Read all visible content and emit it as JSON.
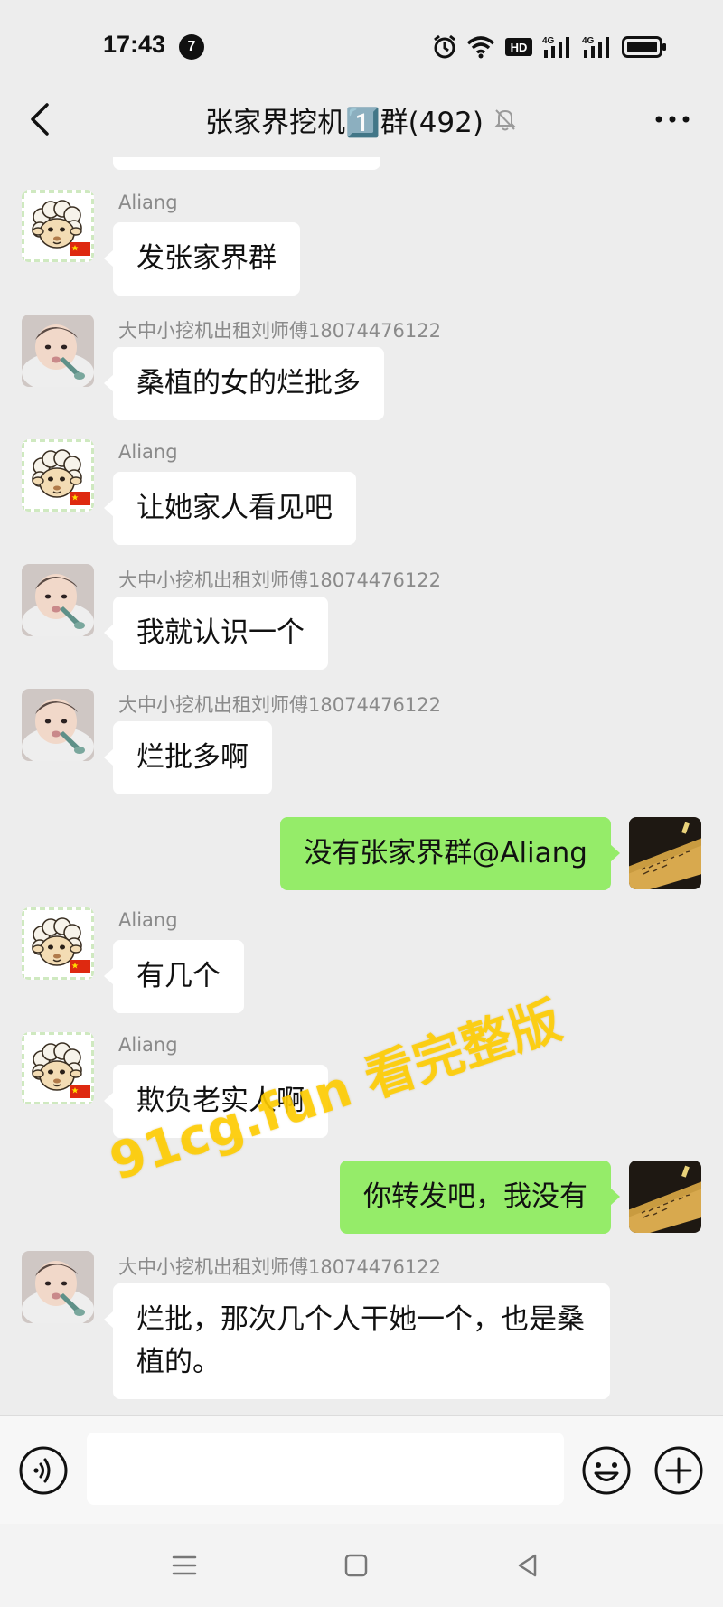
{
  "status_bar": {
    "time": "17:43",
    "notification_count": "7",
    "hd_badge": "HD",
    "signal_1_label": "4G",
    "signal_2_label": "4G"
  },
  "header": {
    "title": "张家界挖机1️⃣群(492)",
    "mute_icon": "bell-off-icon",
    "more_icon": "more-dots-icon"
  },
  "messages": [
    {
      "side": "left",
      "sender": "Aliang",
      "avatar": "lamb-avatar",
      "text": "发张家界群"
    },
    {
      "side": "left",
      "sender": "大中小挖机出租刘师傅18074476122",
      "avatar": "baby-avatar",
      "text": "桑植的女的烂批多"
    },
    {
      "side": "left",
      "sender": "Aliang",
      "avatar": "lamb-avatar",
      "text": "让她家人看见吧"
    },
    {
      "side": "left",
      "sender": "大中小挖机出租刘师傅18074476122",
      "avatar": "baby-avatar",
      "text": "我就认识一个"
    },
    {
      "side": "left",
      "sender": "大中小挖机出租刘师傅18074476122",
      "avatar": "baby-avatar",
      "text": "烂批多啊"
    },
    {
      "side": "right",
      "sender": "",
      "avatar": "self-avatar",
      "text": "没有张家界群@Aliang"
    },
    {
      "side": "left",
      "sender": "Aliang",
      "avatar": "lamb-avatar",
      "text": "有几个"
    },
    {
      "side": "left",
      "sender": "Aliang",
      "avatar": "lamb-avatar",
      "text": "欺负老实人啊"
    },
    {
      "side": "right",
      "sender": "",
      "avatar": "self-avatar",
      "text": "你转发吧，我没有"
    },
    {
      "side": "left",
      "sender": "大中小挖机出租刘师傅18074476122",
      "avatar": "baby-avatar",
      "text": "烂批，那次几个人干她一个，也是桑植的。"
    }
  ],
  "watermark": "91cg.fun 看完整版",
  "input_bar": {
    "placeholder": "",
    "voice_icon": "voice-icon",
    "emoji_icon": "emoji-icon",
    "plus_icon": "plus-icon"
  },
  "nav_bar": {
    "menu_icon": "menu-icon",
    "home_icon": "home-icon",
    "back_icon": "back-triangle-icon"
  }
}
